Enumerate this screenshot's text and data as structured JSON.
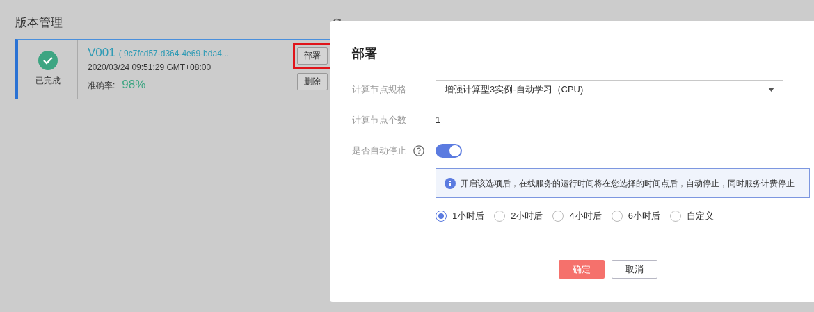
{
  "left_panel": {
    "title": "版本管理",
    "version_card": {
      "status": "已完成",
      "version": "V001",
      "id": "( 9c7fcd57-d364-4e69-bda4...",
      "timestamp": "2020/03/24 09:51:29 GMT+08:00",
      "accuracy_label": "准确率:",
      "accuracy": "98%",
      "buttons": [
        {
          "label": "部署",
          "highlighted": true
        },
        {
          "label": "删除",
          "highlighted": false
        }
      ]
    }
  },
  "dialog": {
    "title": "部署",
    "fields": [
      {
        "kind": "select",
        "label": "计算节点规格",
        "value": "增强计算型3实例-自动学习（CPU)"
      },
      {
        "kind": "text",
        "label": "计算节点个数",
        "value": "1"
      },
      {
        "kind": "switch",
        "label": "是否自动停止",
        "on": true,
        "info": "开启该选项后，在线服务的运行时间将在您选择的时间点后，自动停止，同时服务计费停止",
        "options": [
          {
            "label": "1小时后",
            "selected": true
          },
          {
            "label": "2小时后",
            "selected": false
          },
          {
            "label": "4小时后",
            "selected": false
          },
          {
            "label": "6小时后",
            "selected": false
          },
          {
            "label": "自定义",
            "selected": false
          }
        ]
      }
    ],
    "buttons": [
      {
        "kind": "primary",
        "label": "确定"
      },
      {
        "kind": "secondary",
        "label": "取消"
      }
    ]
  }
}
